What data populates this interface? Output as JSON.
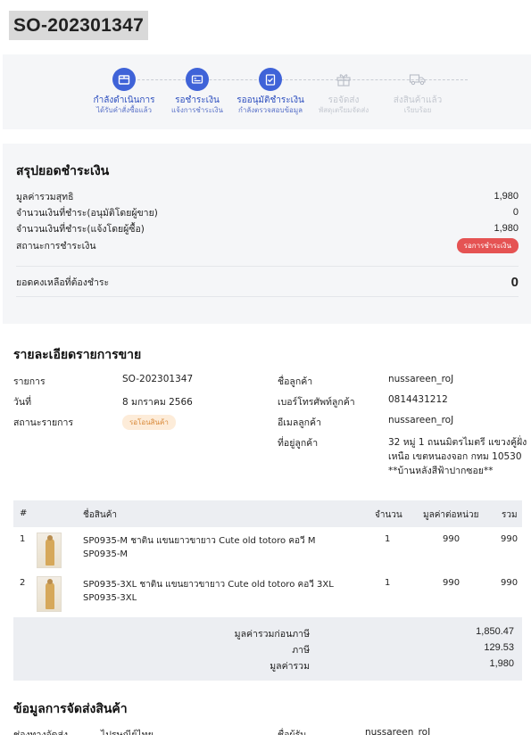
{
  "order": {
    "number": "SO-202301347"
  },
  "stepper": {
    "steps": [
      {
        "label": "กำลังดำเนินการ",
        "sub": "ได้รับคำสั่งซื้อแล้ว",
        "icon": "box-icon",
        "state": "active"
      },
      {
        "label": "รอชำระเงิน",
        "sub": "แจ้งการชำระเงิน",
        "icon": "payment-card-icon",
        "state": "active"
      },
      {
        "label": "รออนุมัติชำระเงิน",
        "sub": "กำลังตรวจสอบข้อมูล",
        "icon": "clipboard-check-icon",
        "state": "active"
      },
      {
        "label": "รอจัดส่ง",
        "sub": "พัสดุเตรียมจัดส่ง",
        "icon": "gift-box-icon",
        "state": "inactive"
      },
      {
        "label": "ส่งสินค้าแล้ว",
        "sub": "เรียบร้อย",
        "icon": "truck-icon",
        "state": "inactive"
      }
    ],
    "colors": {
      "active": "#3f63d8",
      "inactive": "#c4c8d0"
    }
  },
  "payment": {
    "title": "สรุปยอดชำระเงิน",
    "net_label": "มูลค่ารวมสุทธิ",
    "net_value": "1,980",
    "paid_approved_label": "จำนวนเงินที่ชำระ(อนุมัติโดยผู้ขาย)",
    "paid_approved_value": "0",
    "paid_reported_label": "จำนวนเงินที่ชำระ(แจ้งโดยผู้ซื้อ)",
    "paid_reported_value": "1,980",
    "status_label": "สถานะการชำระเงิน",
    "status_badge": "รอการชำระเงิน",
    "status_color": "#e55353",
    "remaining_label": "ยอดคงเหลือที่ต้องชำระ",
    "remaining_value": "0"
  },
  "details": {
    "title": "รายละเอียดรายการขาย",
    "item_label": "รายการ",
    "item_value": "SO-202301347",
    "date_label": "วันที่",
    "date_value": "8 มกราคม 2566",
    "status_label": "สถานะรายการ",
    "status_badge": "รอโอนสินค้า",
    "customer_label": "ชื่อลูกค้า",
    "customer_value": "nussareen_roJ",
    "phone_label": "เบอร์โทรศัพท์ลูกค้า",
    "phone_value": "0814431212",
    "email_label": "อีเมลลูกค้า",
    "email_value": "nussareen_roJ",
    "address_label": "ที่อยู่ลูกค้า",
    "address_value": "32 หมู่ 1 ถนนมิตรไมตรี แขวงคู้ฝั่งเหนือ เขตหนองจอก กทม 10530 **บ้านหลังสีฟ้าปากซอย**"
  },
  "table": {
    "headers": {
      "num": "#",
      "name": "ชื่อสินค้า",
      "qty": "จำนวน",
      "unit_price": "มูลค่าต่อหน่วย",
      "total": "รวม"
    },
    "rows": [
      {
        "num": "1",
        "name": "SP0935-M ชาติน แขนยาวขายาว Cute old totoro คอวี M",
        "sku": "SP0935-M",
        "qty": "1",
        "unit_price": "990",
        "total": "990"
      },
      {
        "num": "2",
        "name": "SP0935-3XL ชาติน แขนยาวขายาว Cute old totoro คอวี 3XL",
        "sku": "SP0935-3XL",
        "qty": "1",
        "unit_price": "990",
        "total": "990"
      }
    ],
    "totals": {
      "subtotal_label": "มูลค่ารวมก่อนภาษี",
      "subtotal_value": "1,850.47",
      "tax_label": "ภาษี",
      "tax_value": "129.53",
      "grand_label": "มูลค่ารวม",
      "grand_value": "1,980"
    }
  },
  "shipping": {
    "title": "ข้อมูลการจัดส่งสินค้า",
    "channel_label": "ช่องทางจัดส่ง",
    "channel_value": "ไปรษณีย์ไทย",
    "recipient_label": "ชื่อผู้รับ",
    "recipient_value": "nussareen_roJ"
  }
}
